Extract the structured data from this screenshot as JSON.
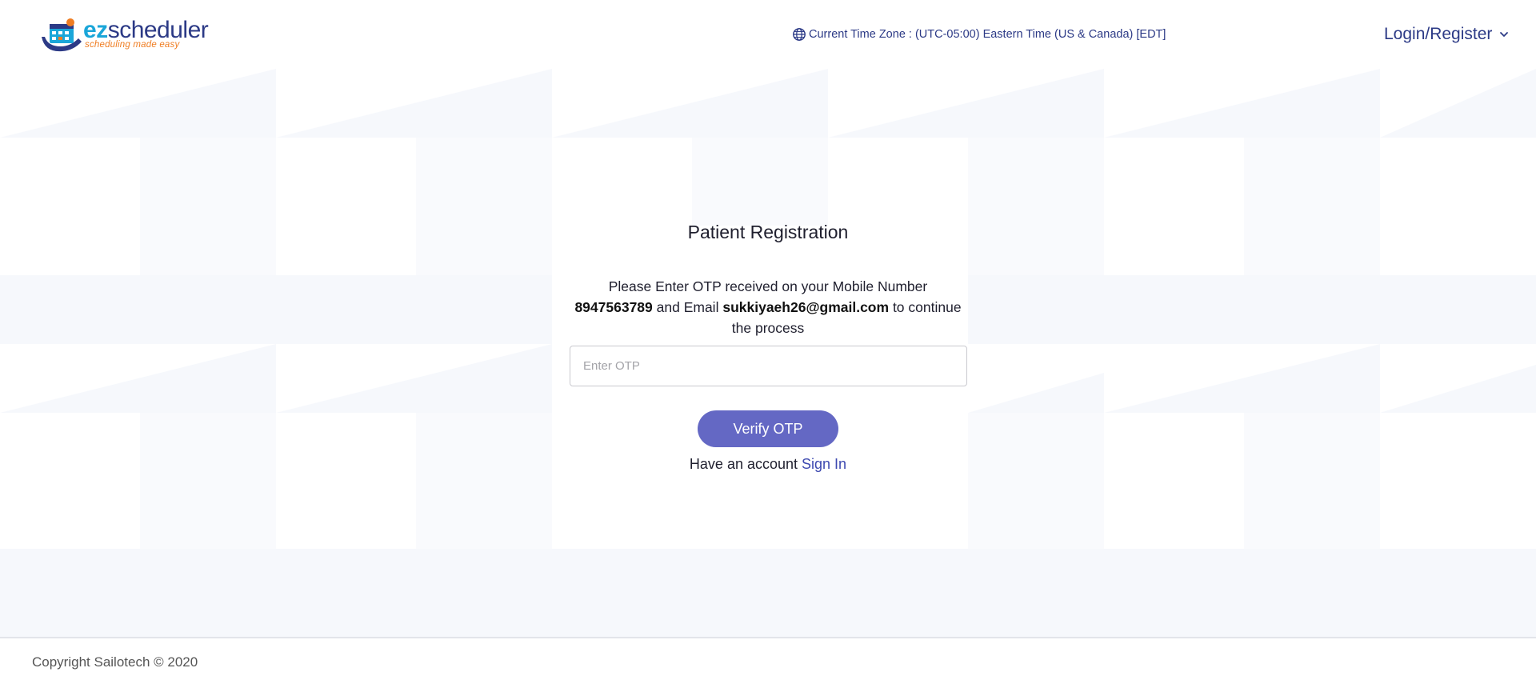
{
  "brand": {
    "wordmark_prefix": "ez",
    "wordmark_rest": "scheduler",
    "tagline": "scheduling made easy",
    "colors": {
      "primary": "#2c3a86",
      "accent": "#1aa6d9",
      "orange": "#ef7d22"
    }
  },
  "header": {
    "timezone_icon": "globe-icon",
    "timezone_text": "Current Time Zone : (UTC-05:00) Eastern Time (US & Canada) [EDT]",
    "login_label": "Login/Register",
    "login_icon": "chevron-down-icon"
  },
  "registration": {
    "title": "Patient Registration",
    "message_prefix": "Please Enter OTP received on your Mobile Number",
    "mobile_number": "8947563789",
    "message_middle": "and Email",
    "email": "sukkiyaeh26@gmail.com",
    "message_suffix": "to continue the process",
    "otp_placeholder": "Enter OTP",
    "otp_value": "",
    "verify_button": "Verify OTP",
    "account_prompt": "Have an account",
    "signin_link": "Sign In",
    "button_color": "#6468c4"
  },
  "footer": {
    "copyright": "Copyright Sailotech © 2020"
  }
}
